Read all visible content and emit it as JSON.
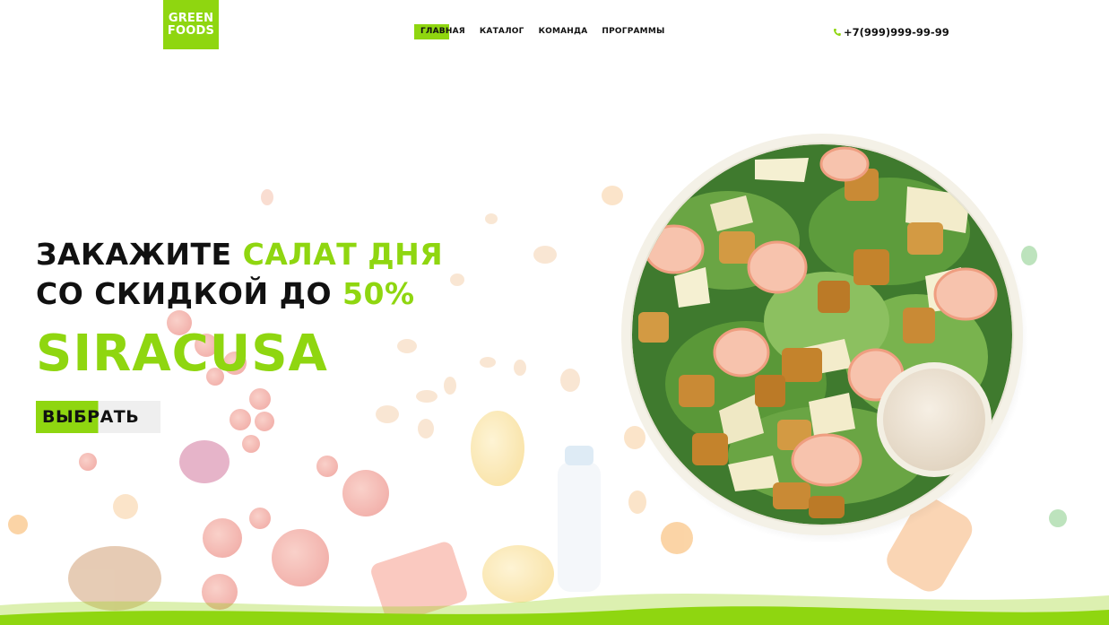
{
  "logo": {
    "line1": "GREEN",
    "line2": "FOODS"
  },
  "nav": {
    "items": [
      {
        "label": "ГЛАВНАЯ",
        "active": true
      },
      {
        "label": "КАТАЛОГ",
        "active": false
      },
      {
        "label": "КОМАНДА",
        "active": false
      },
      {
        "label": "ПРОГРАММЫ",
        "active": false
      }
    ]
  },
  "phone": {
    "icon": "phone-icon",
    "number": "+7(999)999-99-99"
  },
  "hero": {
    "line1_dark": "ЗАКАЖИТЕ ",
    "line1_green": "САЛАТ ДНЯ",
    "line2_dark": "СО СКИДКОЙ ДО ",
    "line2_green": "50%",
    "brand": "SIRACUSA",
    "cta_label": "ВЫБРАТЬ"
  },
  "colors": {
    "accent": "#8fd610",
    "text": "#111111",
    "button_bg": "#efefef"
  }
}
